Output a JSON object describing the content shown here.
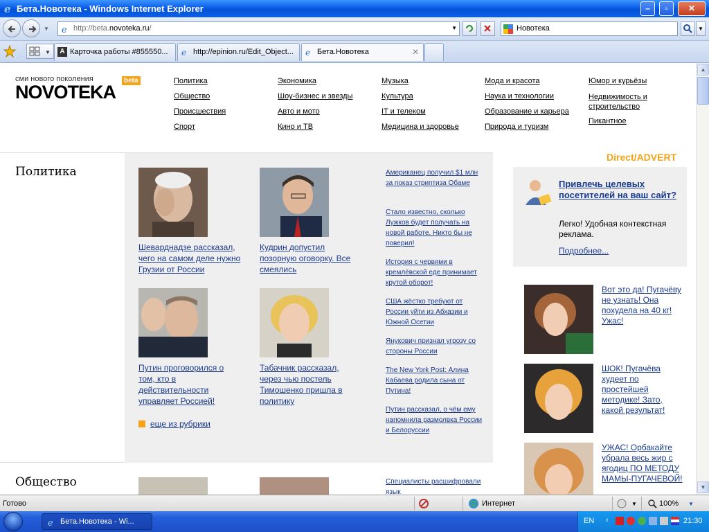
{
  "window": {
    "title": "Бета.Новотека - Windows Internet Explorer"
  },
  "address": {
    "url_gray": "http://beta.",
    "url_domain": "novoteka.ru",
    "url_tail": "/"
  },
  "search_box": {
    "value": "Новотека"
  },
  "tabs": [
    {
      "label": "Карточка работы #855550..."
    },
    {
      "label": "http://epinion.ru/Edit_Object..."
    },
    {
      "label": "Бета.Новотека"
    }
  ],
  "site": {
    "logo_small": "сми нового поколения",
    "logo_big": "NOVOTEKA",
    "logo_badge": "beta",
    "nav": {
      "col1": [
        "Политика",
        "Общество",
        "Происшествия",
        "Спорт"
      ],
      "col2": [
        "Экономика",
        "Шоу-бизнес и звезды",
        "Авто и мото",
        "Кино и ТВ"
      ],
      "col3": [
        "Музыка",
        "Культура",
        "IT и телеком",
        "Медицина и здоровье"
      ],
      "col4": [
        "Мода и красота",
        "Наука и технологии",
        "Образование и карьера",
        "Природа и туризм"
      ],
      "col5a": "Юмор и курьёзы",
      "col5b": "Недвижимость и строительство",
      "col5c": "Пикантное"
    }
  },
  "politics": {
    "title": "Политика",
    "stories": [
      "Шеварднадзе рассказал, чего на самом деле нужно Грузии от России",
      "Кудрин допустил позорную оговорку. Все смеялись",
      "Путин проговорился о том, кто в действительности управляет Россией!",
      "Табачник рассказал, через чью постель Тимошенко пришла в политику"
    ],
    "news": [
      "Американец получил $1 млн за показ стриптиза Обаме",
      "Стало известно, сколько Лужков будет получать на новой работе. Никто бы не поверил!",
      "История с червями в кремлёвской еде принимает крутой оборот!",
      "США жёстко требуют от России уйти из Абхазии и Южной Осетии",
      "Янукович признал угрозу со стороны России",
      "The New York Post: Алина Кабаева родила сына от Путина!",
      "Путин рассказал, о чём ему напомнила размолвка России и Белоруссии"
    ],
    "more": "еще из рубрики"
  },
  "society": {
    "title": "Общество",
    "news_first": "Специалисты расшифровали язык"
  },
  "advert": {
    "head": "Direct/ADVERT",
    "title": "Привлечь целевых посетителей на ваш сайт?",
    "text": "Легко! Удобная контекстная реклама.",
    "more": "Подробнее..."
  },
  "teasers": [
    "Вот это да! Пугачёву не узнать! Она похудела на 40 кг! Ужас!",
    "ШОК! Пугачёва худеет по простейшей методике! Зато, какой результат!",
    "УЖАС! Орбакайте убрала весь жир с ягодиц ПО МЕТОДУ МАМЫ-ПУГАЧЕВОЙ!"
  ],
  "status": {
    "text": "Готово",
    "zone": "Интернет",
    "zoom": "100%"
  },
  "taskbar": {
    "item": "Бета.Новотека - Wi...",
    "lang": "EN",
    "clock": "21:30"
  }
}
